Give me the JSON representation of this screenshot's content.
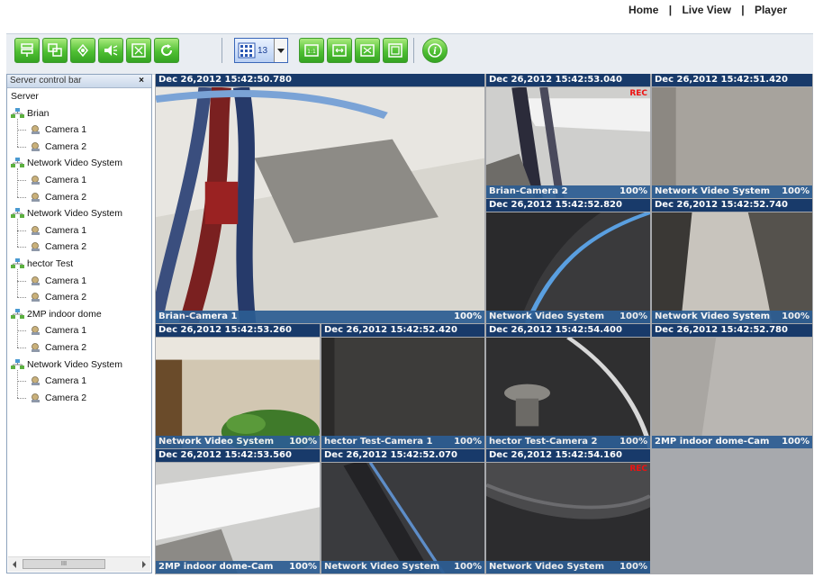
{
  "nav": {
    "home": "Home",
    "live_view": "Live View",
    "player": "Player",
    "separator": "|"
  },
  "toolbar": {
    "buttons": [
      "server-list-icon",
      "layout-icon",
      "settings-icon",
      "audio-icon",
      "snapshot-icon",
      "refresh-icon",
      "grid-layout-icon",
      "original-size-icon",
      "fit-width-icon",
      "full-screen-icon",
      "fit-window-icon",
      "info-icon"
    ],
    "grid_count": "13",
    "accent_green": "#4fbf33",
    "accent_blue": "#2c5d93"
  },
  "sidebar": {
    "title": "Server control bar",
    "close": "×",
    "root": "Server",
    "servers": [
      {
        "name": "Brian",
        "cameras": [
          "Camera 1",
          "Camera 2"
        ]
      },
      {
        "name": "Network Video System",
        "cameras": [
          "Camera 1",
          "Camera 2"
        ]
      },
      {
        "name": "Network Video System",
        "cameras": [
          "Camera 1",
          "Camera 2"
        ]
      },
      {
        "name": "hector Test",
        "cameras": [
          "Camera 1",
          "Camera 2"
        ]
      },
      {
        "name": "2MP indoor dome",
        "cameras": [
          "Camera 1",
          "Camera 2"
        ]
      },
      {
        "name": "Network Video System",
        "cameras": [
          "Camera 1",
          "Camera 2"
        ]
      }
    ],
    "scroll_label": "III"
  },
  "tiles": [
    {
      "ts": "Dec 26,2012 15:42:50.780",
      "caption": "Brian-Camera 1",
      "pct": "100%",
      "rec": "",
      "scene": "ceiling-cable"
    },
    {
      "ts": "Dec 26,2012 15:42:53.040",
      "caption": "Brian-Camera 2",
      "pct": "100%",
      "rec": "REC",
      "scene": "ceiling-light"
    },
    {
      "ts": "Dec 26,2012 15:42:51.420",
      "caption": "Network Video System",
      "pct": "100%",
      "rec": "",
      "scene": "grey-wall"
    },
    {
      "ts": "Dec 26,2012 15:42:52.820",
      "caption": "Network Video System",
      "pct": "100%",
      "rec": "",
      "scene": "dark-curve"
    },
    {
      "ts": "Dec 26,2012 15:42:52.740",
      "caption": "Network Video System",
      "pct": "100%",
      "rec": "",
      "scene": "dark-bracket"
    },
    {
      "ts": "Dec 26,2012 15:42:53.260",
      "caption": "Network Video System",
      "pct": "100%",
      "rec": "",
      "scene": "plant-room"
    },
    {
      "ts": "Dec 26,2012 15:42:52.420",
      "caption": "hector Test-Camera 1",
      "pct": "100%",
      "rec": "",
      "scene": "dark-grey"
    },
    {
      "ts": "Dec 26,2012 15:42:54.400",
      "caption": "hector Test-Camera 2",
      "pct": "100%",
      "rec": "",
      "scene": "camera-mount"
    },
    {
      "ts": "Dec 26,2012 15:42:52.780",
      "caption": "2MP indoor dome-Cam",
      "pct": "100%",
      "rec": "",
      "scene": "pale-grey"
    },
    {
      "ts": "Dec 26,2012 15:42:53.560",
      "caption": "2MP indoor dome-Cam",
      "pct": "100%",
      "rec": "",
      "scene": "bright-light"
    },
    {
      "ts": "Dec 26,2012 15:42:52.070",
      "caption": "Network Video System",
      "pct": "100%",
      "rec": "",
      "scene": "dark-diagonal"
    },
    {
      "ts": "Dec 26,2012 15:42:54.160",
      "caption": "Network Video System",
      "pct": "100%",
      "rec": "REC",
      "scene": "dark-arc"
    }
  ]
}
